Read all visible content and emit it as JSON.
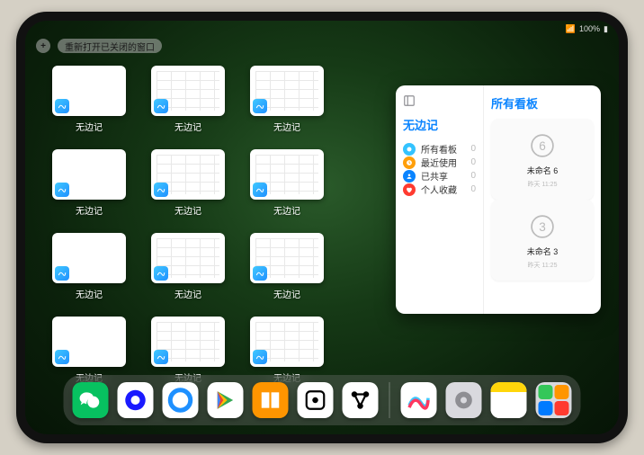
{
  "status": {
    "battery": "100%",
    "wifi": "wifi"
  },
  "toolbar": {
    "add": "+",
    "reopen": "重新打开已关闭的窗口"
  },
  "app_label": "无边记",
  "tiles": [
    "blank",
    "cal",
    "cal",
    "blank",
    "cal",
    "cal",
    "blank",
    "cal",
    "cal",
    "blank",
    "cal",
    "cal"
  ],
  "panel": {
    "dots": "···",
    "sidebar_title": "无边记",
    "items": [
      {
        "icon": "cloud",
        "color": "#34c3ff",
        "label": "所有看板",
        "count": "0"
      },
      {
        "icon": "clock",
        "color": "#ff9f0a",
        "label": "最近使用",
        "count": "0"
      },
      {
        "icon": "people",
        "color": "#0a84ff",
        "label": "已共享",
        "count": "0"
      },
      {
        "icon": "heart",
        "color": "#ff3b30",
        "label": "个人收藏",
        "count": "0"
      }
    ],
    "main_title": "所有看板",
    "boards": [
      {
        "num": "6",
        "label": "未命名 6",
        "sub": "昨天 11:25"
      },
      {
        "num": "3",
        "label": "未命名 3",
        "sub": "昨天 11:25"
      }
    ]
  },
  "dock": {
    "apps": [
      {
        "name": "wechat",
        "bg": "#07c160",
        "glyph": "wechat"
      },
      {
        "name": "quark",
        "bg": "#ffffff",
        "glyph": "quark"
      },
      {
        "name": "qqbrowser",
        "bg": "#ffffff",
        "glyph": "qqb"
      },
      {
        "name": "play",
        "bg": "#ffffff",
        "glyph": "play"
      },
      {
        "name": "books",
        "bg": "#fe9500",
        "glyph": "books"
      },
      {
        "name": "dice",
        "bg": "#ffffff",
        "glyph": "dice"
      },
      {
        "name": "node",
        "bg": "#ffffff",
        "glyph": "node"
      }
    ],
    "recent": [
      {
        "name": "freeform",
        "bg": "#ffffff",
        "glyph": "freeform"
      },
      {
        "name": "settings",
        "bg": "#d9d9de",
        "glyph": "gear"
      },
      {
        "name": "notes",
        "bg": "#ffffff",
        "glyph": "notes"
      },
      {
        "name": "library",
        "bg": "#d9d9de",
        "glyph": "library"
      }
    ]
  }
}
